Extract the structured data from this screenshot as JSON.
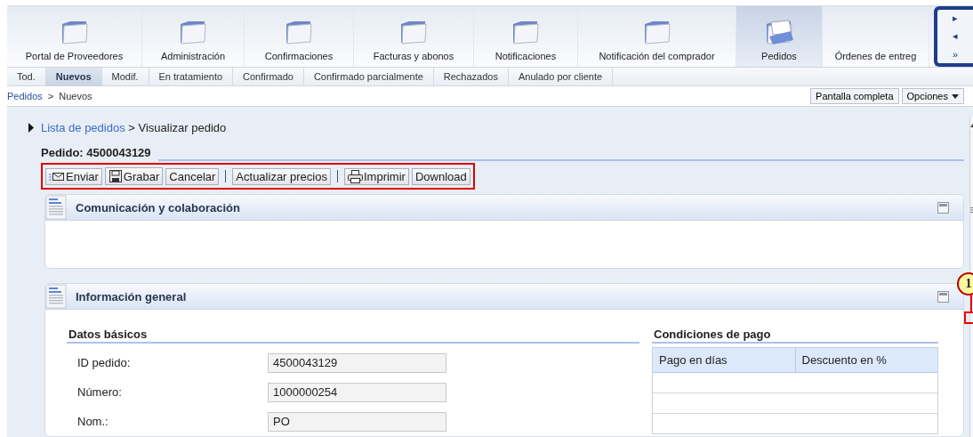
{
  "main_tabs": [
    {
      "label": "Portal de Proveedores",
      "selected": false
    },
    {
      "label": "Administración",
      "selected": false
    },
    {
      "label": "Confirmaciones",
      "selected": false
    },
    {
      "label": "Facturas y abonos",
      "selected": false
    },
    {
      "label": "Notificaciones",
      "selected": false
    },
    {
      "label": "Notificación del comprador",
      "selected": false
    },
    {
      "label": "Pedidos",
      "selected": true
    },
    {
      "label": "Órdenes de entreg",
      "selected": false
    }
  ],
  "tab_nav": {
    "buttons": [
      "▸",
      "◂",
      "»"
    ]
  },
  "sub_tabs": [
    {
      "label": "Tod.",
      "selected": false
    },
    {
      "label": "Nuevos",
      "selected": true
    },
    {
      "label": "Modif.",
      "selected": false
    },
    {
      "label": "En tratamiento",
      "selected": false
    },
    {
      "label": "Confirmado",
      "selected": false
    },
    {
      "label": "Confirmado parcialmente",
      "selected": false
    },
    {
      "label": "Rechazados",
      "selected": false
    },
    {
      "label": "Anulado por cliente",
      "selected": false
    }
  ],
  "path": {
    "items": [
      "Pedidos",
      "Nuevos"
    ],
    "separator": ">"
  },
  "view_buttons": [
    {
      "label": "Pantalla completa",
      "kind": "plain"
    },
    {
      "label": "Opciones",
      "kind": "menu"
    }
  ],
  "breadcrumb": {
    "link": "Lista de pedidos",
    "current": "> Visualizar pedido"
  },
  "order_title": "Pedido: 4500043129",
  "toolbar": [
    {
      "kind": "mail",
      "label": "Enviar"
    },
    {
      "kind": "disk",
      "label": "Grabar"
    },
    {
      "kind": "text",
      "label": "Cancelar"
    },
    {
      "kind": "separator"
    },
    {
      "kind": "text",
      "label": "Actualizar precios"
    },
    {
      "kind": "separator"
    },
    {
      "kind": "printer",
      "label": "Imprimir"
    },
    {
      "kind": "text",
      "label": "Download"
    }
  ],
  "panels": [
    {
      "title": "Comunicación y colaboración",
      "expanded": true
    },
    {
      "title": "Información general",
      "expanded": true,
      "basic_data": {
        "title": "Datos básicos",
        "fields": [
          {
            "label": "ID pedido:",
            "value": "4500043129"
          },
          {
            "label": "Número:",
            "value": "1000000254"
          },
          {
            "label": "Nom.:",
            "value": "PO"
          }
        ]
      },
      "payment": {
        "title": "Condiciones de pago",
        "columns": [
          "Pago en días",
          "Descuento en %"
        ]
      }
    }
  ],
  "callout": {
    "label": "1"
  }
}
